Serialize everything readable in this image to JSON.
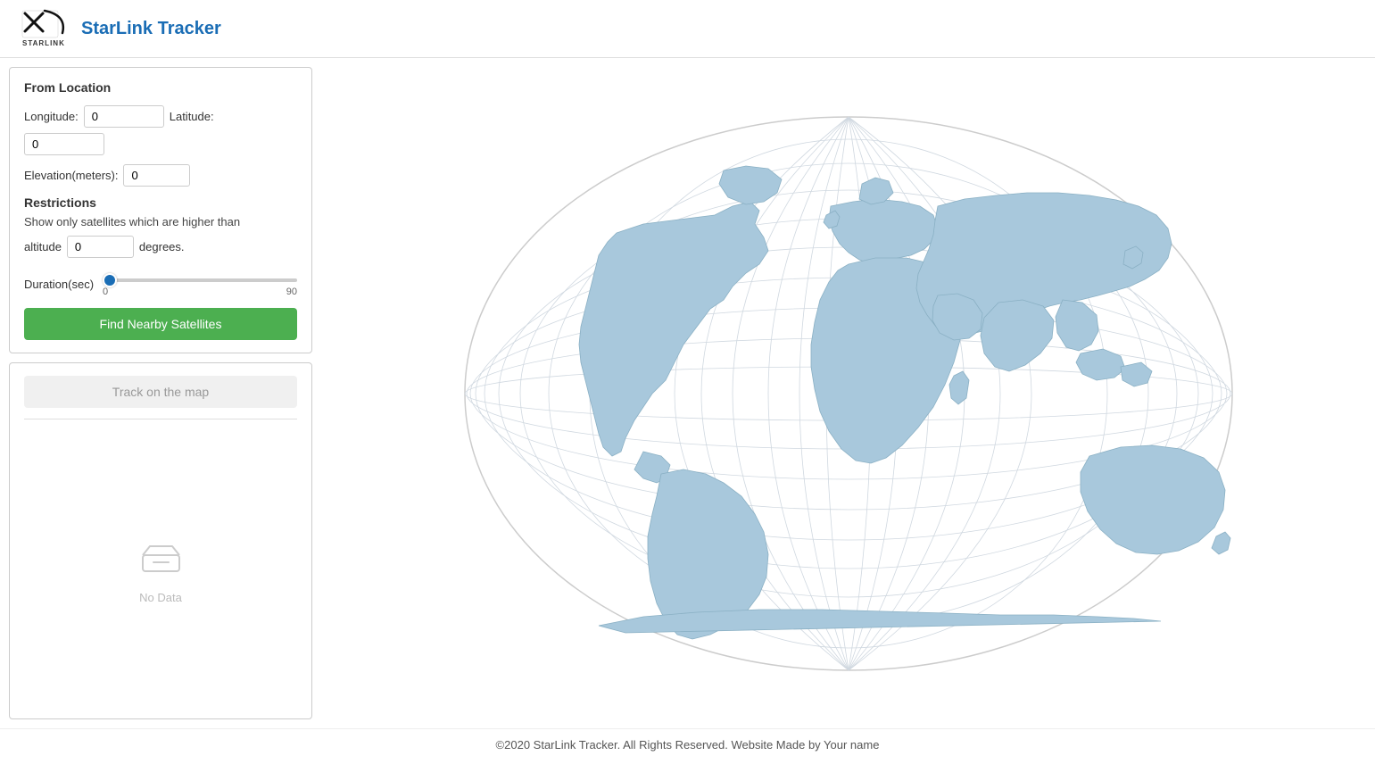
{
  "header": {
    "title": "StarLink Tracker",
    "logo_alt": "SpaceX StarLink Logo"
  },
  "form": {
    "from_location_label": "From Location",
    "longitude_label": "Longitude:",
    "longitude_value": "0",
    "latitude_label": "Latitude:",
    "latitude_value": "0",
    "elevation_label": "Elevation(meters):",
    "elevation_value": "0",
    "restrictions_label": "Restrictions",
    "restrictions_text": "Show only satellites which are higher than",
    "altitude_label": "altitude",
    "altitude_value": "0",
    "degrees_label": "degrees.",
    "duration_label": "Duration(sec)",
    "duration_min": "0",
    "duration_max": "90",
    "duration_value": 0,
    "find_button_label": "Find Nearby Satellites"
  },
  "track_panel": {
    "track_button_label": "Track on the map",
    "no_data_label": "No Data"
  },
  "footer": {
    "text": "©2020 StarLink Tracker. All Rights Reserved. Website Made by Your name"
  }
}
